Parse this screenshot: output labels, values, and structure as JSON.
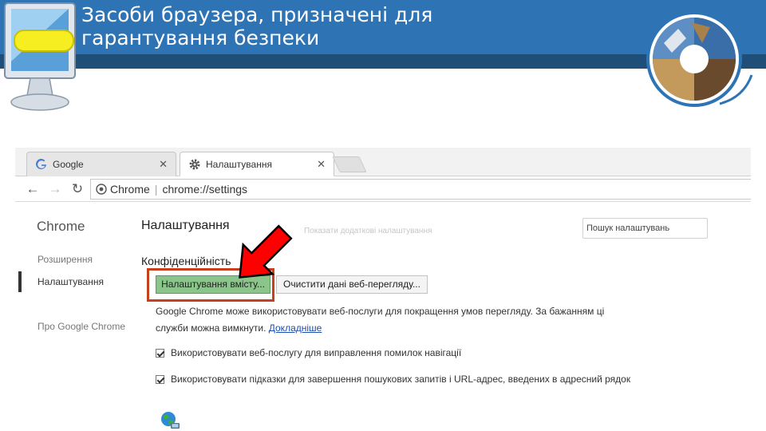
{
  "slide": {
    "title_line1": "Засоби браузера, призначені для",
    "title_line2": "гарантування безпеки",
    "colors": {
      "header": "#2e74b5",
      "stripe": "#1f4e79",
      "highlight": "#c8401b",
      "arrow": "#ff0000",
      "button_green": "#8bc58b"
    }
  },
  "browser": {
    "tabs": [
      {
        "label": "Google",
        "icon": "google-g-icon",
        "close": "✕"
      },
      {
        "label": "Налаштування",
        "icon": "gear-icon",
        "close": "✕"
      }
    ],
    "toolbar": {
      "back": "←",
      "forward": "→",
      "reload": "↻",
      "omnibox_label": "Chrome",
      "separator": "|",
      "url": "chrome://settings"
    },
    "sidebar": {
      "title": "Chrome",
      "items": [
        {
          "label": "Розширення",
          "active": false
        },
        {
          "label": "Налаштування",
          "active": true
        },
        {
          "label": "Про Google Chrome",
          "active": false
        }
      ]
    },
    "settings": {
      "title": "Налаштування",
      "faded_text": "Показати додаткові налаштування",
      "search_placeholder": "Пошук налаштувань",
      "section_title": "Конфіденційність",
      "content_settings_button": "Налаштування вмісту...",
      "clear_data_button": "Очистити дані веб-перегляду...",
      "description": "Google Chrome може використовувати веб-послуги для покращення умов перегляду. За бажанням ці служби можна вимкнути.",
      "learn_more": "Докладніше",
      "checkboxes": [
        {
          "label": "Використовувати веб-послугу для виправлення помилок навігації",
          "checked": true
        },
        {
          "label": "Використовувати підказки для завершення пошукових запитів і URL-адрес, введених в адресний рядок",
          "checked": true
        }
      ]
    }
  }
}
